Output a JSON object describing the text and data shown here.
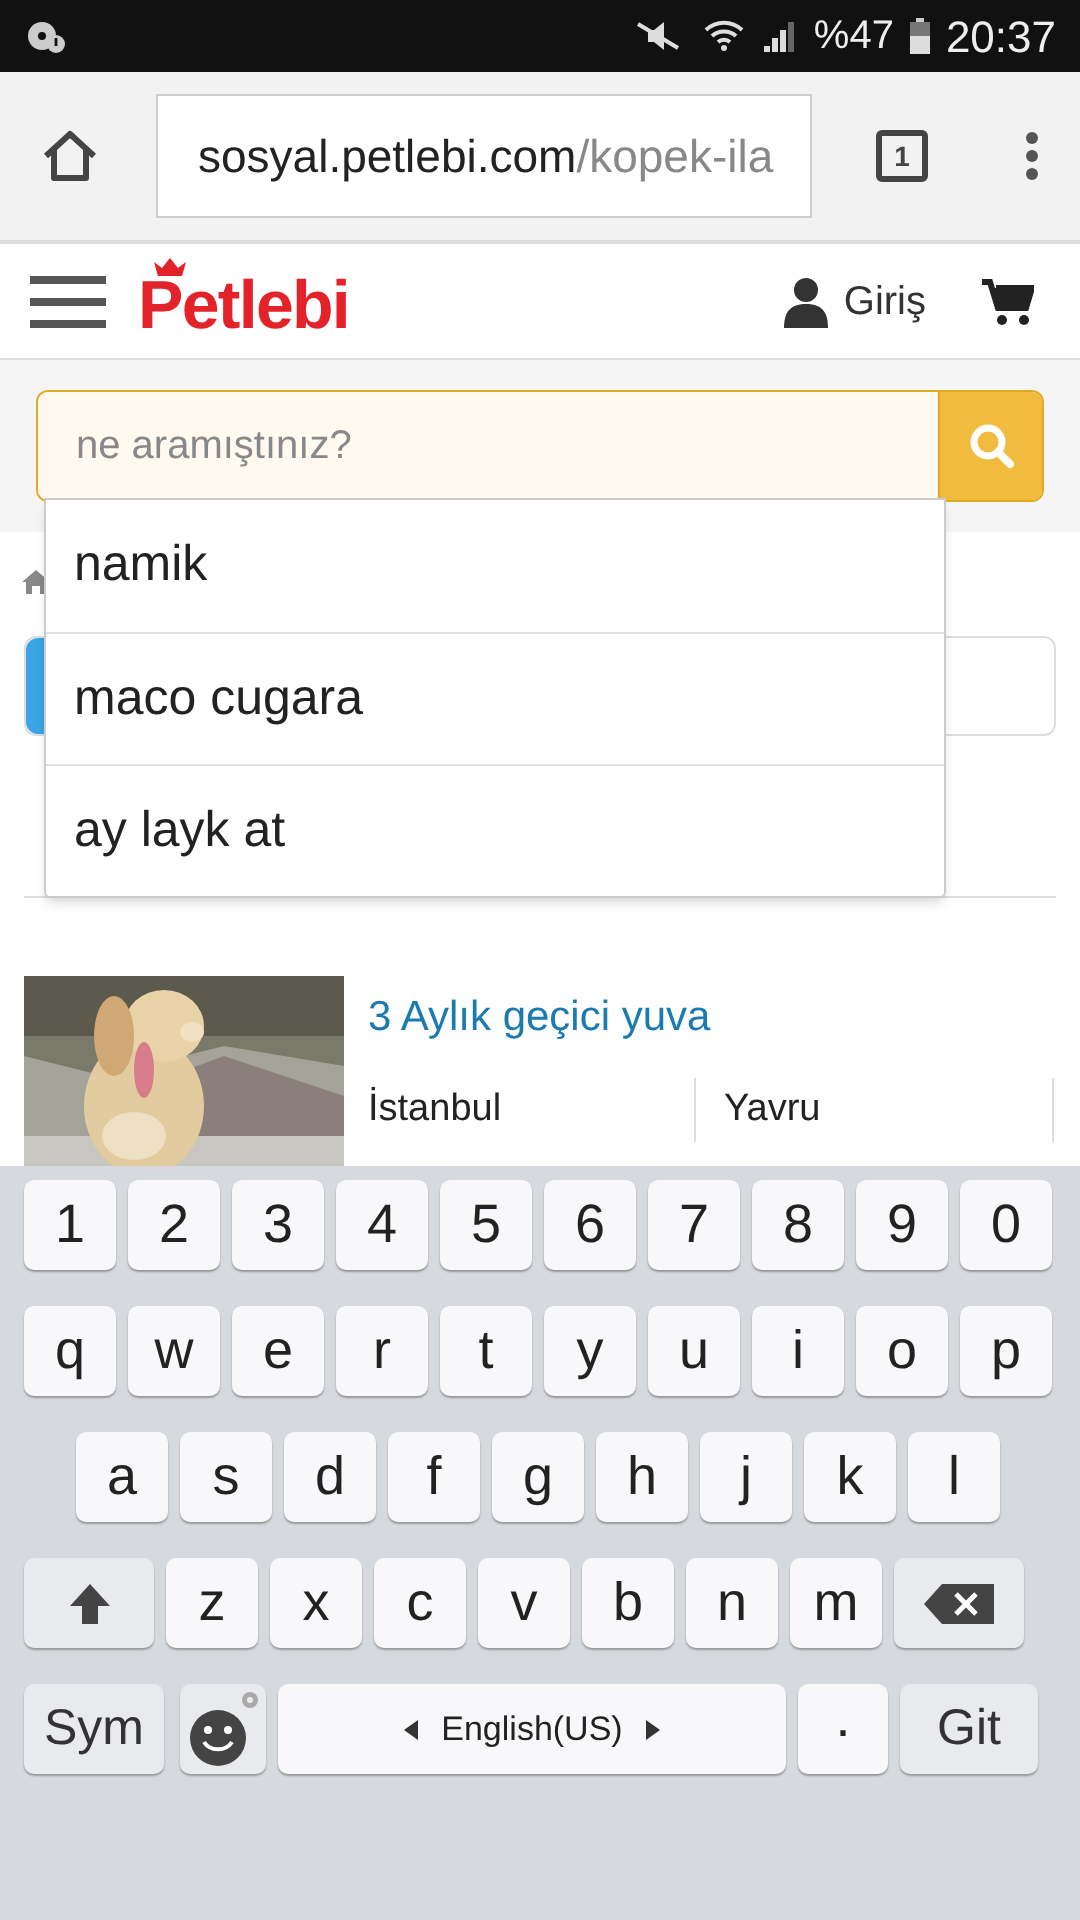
{
  "status_bar": {
    "battery": "%47",
    "time": "20:37"
  },
  "browser": {
    "url_host": "sosyal.petlebi.com",
    "url_path": "/kopek-ila",
    "tab_count": "1"
  },
  "header": {
    "logo": "Petlebi",
    "login": "Giriş"
  },
  "search": {
    "placeholder": "ne aramıştınız?",
    "suggestions": [
      "namik",
      "maco cugara",
      "ay layk at"
    ]
  },
  "listing": {
    "title": "3 Aylık geçici yuva",
    "city": "İstanbul",
    "age": "Yavru"
  },
  "keyboard": {
    "rows": [
      {
        "keys": [
          {
            "kind": "char",
            "label": "1"
          },
          {
            "kind": "char",
            "label": "2"
          },
          {
            "kind": "char",
            "label": "3"
          },
          {
            "kind": "char",
            "label": "4"
          },
          {
            "kind": "char",
            "label": "5"
          },
          {
            "kind": "char",
            "label": "6"
          },
          {
            "kind": "char",
            "label": "7"
          },
          {
            "kind": "char",
            "label": "8"
          },
          {
            "kind": "char",
            "label": "9"
          },
          {
            "kind": "char",
            "label": "0"
          }
        ]
      },
      {
        "keys": [
          {
            "kind": "char",
            "label": "q"
          },
          {
            "kind": "char",
            "label": "w"
          },
          {
            "kind": "char",
            "label": "e"
          },
          {
            "kind": "char",
            "label": "r"
          },
          {
            "kind": "char",
            "label": "t"
          },
          {
            "kind": "char",
            "label": "y"
          },
          {
            "kind": "char",
            "label": "u"
          },
          {
            "kind": "char",
            "label": "i"
          },
          {
            "kind": "char",
            "label": "o"
          },
          {
            "kind": "char",
            "label": "p"
          }
        ]
      },
      {
        "keys": [
          {
            "kind": "char",
            "label": "a"
          },
          {
            "kind": "char",
            "label": "s"
          },
          {
            "kind": "char",
            "label": "d"
          },
          {
            "kind": "char",
            "label": "f"
          },
          {
            "kind": "char",
            "label": "g"
          },
          {
            "kind": "char",
            "label": "h"
          },
          {
            "kind": "char",
            "label": "j"
          },
          {
            "kind": "char",
            "label": "k"
          },
          {
            "kind": "char",
            "label": "l"
          }
        ]
      },
      {
        "keys": [
          {
            "kind": "shift"
          },
          {
            "kind": "char",
            "label": "z"
          },
          {
            "kind": "char",
            "label": "x"
          },
          {
            "kind": "char",
            "label": "c"
          },
          {
            "kind": "char",
            "label": "v"
          },
          {
            "kind": "char",
            "label": "b"
          },
          {
            "kind": "char",
            "label": "n"
          },
          {
            "kind": "char",
            "label": "m"
          },
          {
            "kind": "backspace"
          }
        ]
      },
      {
        "keys": [
          {
            "kind": "sym",
            "label": "Sym"
          },
          {
            "kind": "emoji"
          },
          {
            "kind": "space",
            "label": "English(US)"
          },
          {
            "kind": "char",
            "label": "."
          },
          {
            "kind": "go",
            "label": "Git"
          }
        ]
      }
    ]
  }
}
